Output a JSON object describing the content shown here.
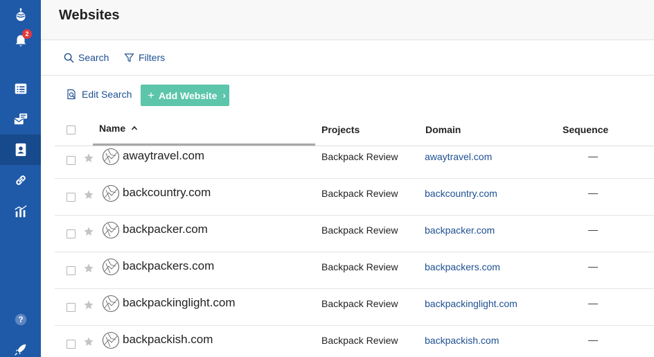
{
  "sidebar": {
    "notifications_badge": "2",
    "items": [
      {
        "icon": "logo-icon"
      },
      {
        "icon": "bell-icon"
      },
      {
        "icon": "list-icon"
      },
      {
        "icon": "mailbox-icon"
      },
      {
        "icon": "contact-book-icon",
        "active": true
      },
      {
        "icon": "link-icon"
      },
      {
        "icon": "chart-icon"
      },
      {
        "icon": "help-icon"
      },
      {
        "icon": "rocket-icon"
      }
    ]
  },
  "header": {
    "title": "Websites"
  },
  "toolbar": {
    "search_label": "Search",
    "filters_label": "Filters"
  },
  "actions": {
    "edit_search_label": "Edit Search",
    "add_website_label": "Add Website"
  },
  "table": {
    "columns": {
      "name": "Name",
      "projects": "Projects",
      "domain": "Domain",
      "sequence": "Sequence"
    },
    "sort": {
      "column": "Name",
      "direction": "ascending"
    },
    "rows": [
      {
        "name": "awaytravel.com",
        "project": "Backpack Review",
        "domain": "awaytravel.com",
        "sequence": "—"
      },
      {
        "name": "backcountry.com",
        "project": "Backpack Review",
        "domain": "backcountry.com",
        "sequence": "—"
      },
      {
        "name": "backpacker.com",
        "project": "Backpack Review",
        "domain": "backpacker.com",
        "sequence": "—"
      },
      {
        "name": "backpackers.com",
        "project": "Backpack Review",
        "domain": "backpackers.com",
        "sequence": "—"
      },
      {
        "name": "backpackinglight.com",
        "project": "Backpack Review",
        "domain": "backpackinglight.com",
        "sequence": "—"
      },
      {
        "name": "backpackish.com",
        "project": "Backpack Review",
        "domain": "backpackish.com",
        "sequence": "—"
      }
    ]
  },
  "colors": {
    "sidebar": "#1f5aa8",
    "link": "#1d4f91",
    "add_button": "#5cc5aa",
    "badge": "#e0393e"
  }
}
